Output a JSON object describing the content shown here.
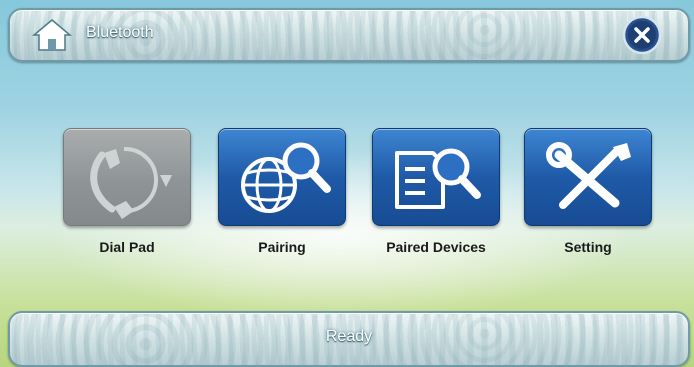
{
  "header": {
    "title": "Bluetooth",
    "home_icon": "home-icon",
    "close_icon": "close-icon"
  },
  "menu": {
    "items": [
      {
        "label": "Dial Pad",
        "icon": "phone-icon",
        "enabled": false
      },
      {
        "label": "Pairing",
        "icon": "globe-search-icon",
        "enabled": true
      },
      {
        "label": "Paired Devices",
        "icon": "document-search-icon",
        "enabled": true
      },
      {
        "label": "Setting",
        "icon": "tools-icon",
        "enabled": true
      }
    ]
  },
  "footer": {
    "status": "Ready"
  },
  "colors": {
    "tile_active": "#1f5aa8",
    "tile_disabled": "#8f9496",
    "label_text": "#1a1a1a"
  }
}
